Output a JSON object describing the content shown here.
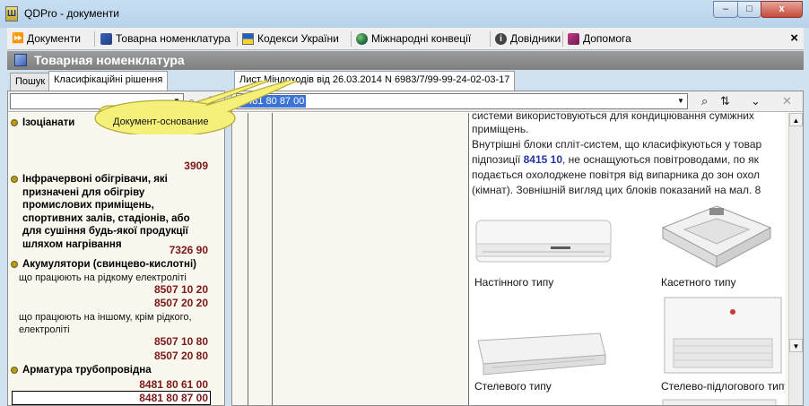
{
  "window": {
    "title": "QDPro - документи",
    "buttons": {
      "minimize": "–",
      "maximize": "□",
      "close": "x"
    }
  },
  "menu": {
    "items": [
      {
        "label": "Документи",
        "icon": "fast-forward-icon"
      },
      {
        "label": "Товарна номенклатура",
        "icon": "book-icon"
      },
      {
        "label": "Кодекси України",
        "icon": "flag-icon"
      },
      {
        "label": "Міжнародні конвеції",
        "icon": "globe-icon"
      },
      {
        "label": "Довідники",
        "icon": "info-icon"
      },
      {
        "label": "Допомога",
        "icon": "help-book-icon"
      }
    ],
    "close": "×"
  },
  "section": {
    "title": "Товарная номенклатура"
  },
  "left_tabs": [
    "Пошук",
    "Класифікаційні рішення"
  ],
  "right_tab": "Лист Міндоходів від 26.03.2014 N 6983/7/99-99-24-02-03-17",
  "callout": "Документ-основание",
  "left_list": {
    "groups": [
      {
        "title": "Ізоціанати",
        "code": "3909"
      },
      {
        "title_lines": [
          "Інфрачервоні обігрівачи, які",
          "призначені для обігріву",
          "промислових приміщень,",
          "спортивних залів, стадіонів, або",
          "для сушіння будь-якої продукції",
          "шляхом нагрівання"
        ],
        "code": "7326 90"
      },
      {
        "title": "Акумулятори (свинцево-кислотні)"
      },
      {
        "title": "Арматура трубопровідна"
      }
    ],
    "sub_items": [
      {
        "text": "що працюють на рідкому електроліті",
        "codes": [
          "8507 10 20",
          "8507 20 20"
        ]
      },
      {
        "text_lines": [
          "що працюють на іншому, крім рідкого,",
          "електроліті"
        ],
        "codes": [
          "8507 10 80",
          "8507 20 80"
        ]
      }
    ],
    "fitting_codes": [
      "8481 80 61 00",
      "8481 80 87 00"
    ]
  },
  "search": {
    "value": "8481 80 87 00"
  },
  "document": {
    "line1": "системи використовуються для кондиціювання суміжних",
    "line2": "приміщень.",
    "line3": "Внутрішні блоки спліт-систем, що класифікуються у товар",
    "line4_pre": "підпозиції ",
    "line4_code": "8415 10",
    "line4_post": ", не оснащуються повітроводами, по як",
    "line5": "подається охолоджене повітря від випарника до зон охол",
    "line6": "(кімнат). Зовнішній вигляд цих блоків показаний на мал. 8",
    "captions": [
      "Настінного типу",
      "Касетного типу",
      "Стелевого типу",
      "Стелево-підлогового типу"
    ]
  }
}
